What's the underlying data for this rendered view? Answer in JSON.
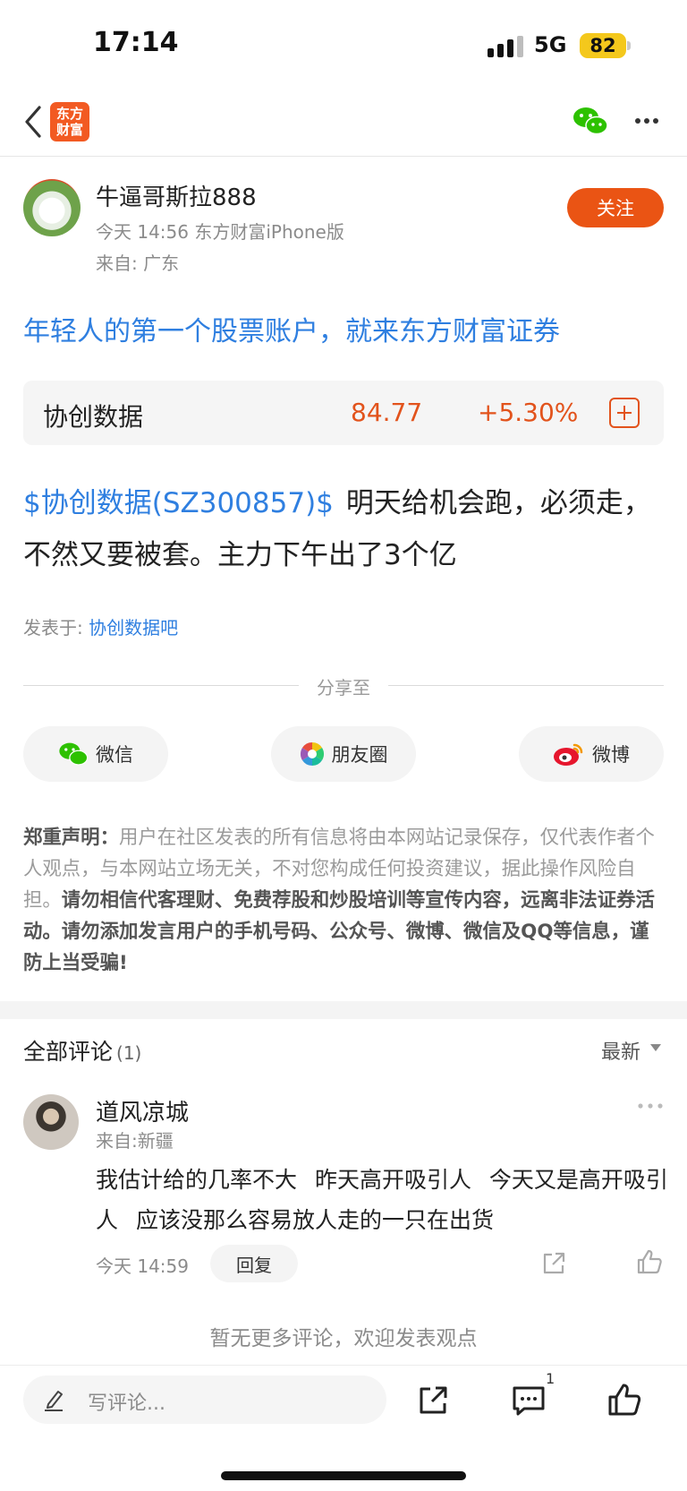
{
  "status_bar": {
    "time": "17:14",
    "network": "5G",
    "battery": "82"
  },
  "nav": {
    "logo_line1": "东方",
    "logo_line2": "财富"
  },
  "author": {
    "name": "牛逼哥斯拉888",
    "meta": "今天 14:56  东方财富iPhone版",
    "location": "来自: 广东",
    "follow_label": "关注"
  },
  "ad_link": "年轻人的第一个股票账户，就来东方财富证券",
  "stock": {
    "name": "协创数据",
    "price": "84.77",
    "change": "+5.30%"
  },
  "post": {
    "tag": "$协创数据(SZ300857)$",
    "text": "明天给机会跑，必须走，不然又要被套。主力下午出了3个亿",
    "posted_in_label": "发表于: ",
    "board": "协创数据吧"
  },
  "share": {
    "title": "分享至",
    "wechat": "微信",
    "moments": "朋友圈",
    "weibo": "微博"
  },
  "disclaimer": {
    "head": "郑重声明：",
    "normal": "用户在社区发表的所有信息将由本网站记录保存，仅代表作者个人观点，与本网站立场无关，不对您构成任何投资建议，据此操作风险自担。",
    "strong": "请勿相信代客理财、免费荐股和炒股培训等宣传内容，远离非法证券活动。请勿添加发言用户的手机号码、公众号、微博、微信及QQ等信息，谨防上当受骗!"
  },
  "comments": {
    "title": "全部评论",
    "count": "(1)",
    "sort": "最新",
    "items": [
      {
        "name": "道风凉城",
        "from": "来自:新疆",
        "text": "我估计给的几率不大  昨天高开吸引人  今天又是高开吸引人  应该没那么容易放人走的一只在出货",
        "time": "今天 14:59",
        "reply_label": "回复"
      }
    ],
    "no_more": "暂无更多评论，欢迎发表观点"
  },
  "bottom_bar": {
    "placeholder": "写评论...",
    "comment_badge": "1"
  },
  "colors": {
    "accent_orange": "#ea5414",
    "link_blue": "#2f7fe0",
    "stock_red": "#e2531c"
  }
}
